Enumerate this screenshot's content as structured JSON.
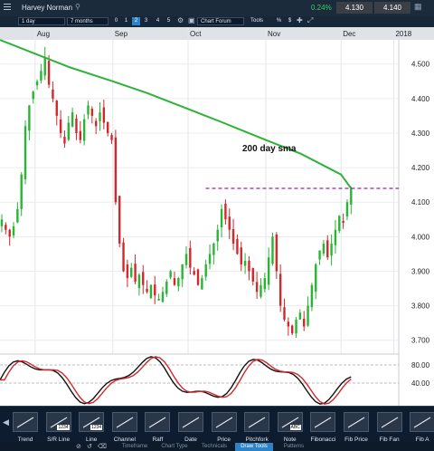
{
  "header": {
    "title": "Harvey Norman",
    "change_pct": "0.24%",
    "bid": "4.130",
    "ask": "4.140"
  },
  "toolbar": {
    "interval": "1 day",
    "range": "7 months",
    "chart_buttons": [
      "0",
      "1",
      "2",
      "3",
      "4",
      "5"
    ],
    "chart_forum": "Chart Forum",
    "tools_label": "Tools",
    "percent_label": "%",
    "info_label": "$"
  },
  "chart_data": {
    "type": "candlestick",
    "title": "",
    "x_labels": [
      "Aug",
      "Sep",
      "Oct",
      "Nov",
      "Dec",
      "2018"
    ],
    "y_ticks": [
      "4.500",
      "4.400",
      "4.300",
      "4.200",
      "4.100",
      "4.000",
      "3.900",
      "3.800",
      "3.700"
    ],
    "ylim": [
      3.66,
      4.57
    ],
    "annotation": "200 day sma",
    "resistance_level": 4.14,
    "sma_200": [
      {
        "x": "Jul 18",
        "y": 4.57
      },
      {
        "x": "Aug 1",
        "y": 4.53
      },
      {
        "x": "Aug 15",
        "y": 4.49
      },
      {
        "x": "Sep 1",
        "y": 4.45
      },
      {
        "x": "Sep 15",
        "y": 4.415
      },
      {
        "x": "Oct 1",
        "y": 4.37
      },
      {
        "x": "Oct 15",
        "y": 4.33
      },
      {
        "x": "Nov 1",
        "y": 4.28
      },
      {
        "x": "Nov 15",
        "y": 4.24
      },
      {
        "x": "Dec 1",
        "y": 4.18
      },
      {
        "x": "Dec 5",
        "y": 4.14
      }
    ],
    "oscillator": {
      "ticks": [
        "80.00",
        "40.00"
      ],
      "ylim": [
        0,
        100
      ]
    }
  },
  "drawing_tools": [
    "Trend",
    "S/R Line",
    "Line",
    "Channel",
    "Raff",
    "Date",
    "Price",
    "Pitchfork",
    "Note",
    "Fibonacci",
    "Fib Price",
    "Fib Fan",
    "Fib A"
  ],
  "tool_badges": {
    "srline": "1234",
    "line": "1234",
    "note": "ABC"
  },
  "tabs": [
    "Timeframe",
    "Chart Type",
    "Technicals",
    "Draw Tools",
    "Patterns"
  ],
  "active_tab": "Draw Tools"
}
